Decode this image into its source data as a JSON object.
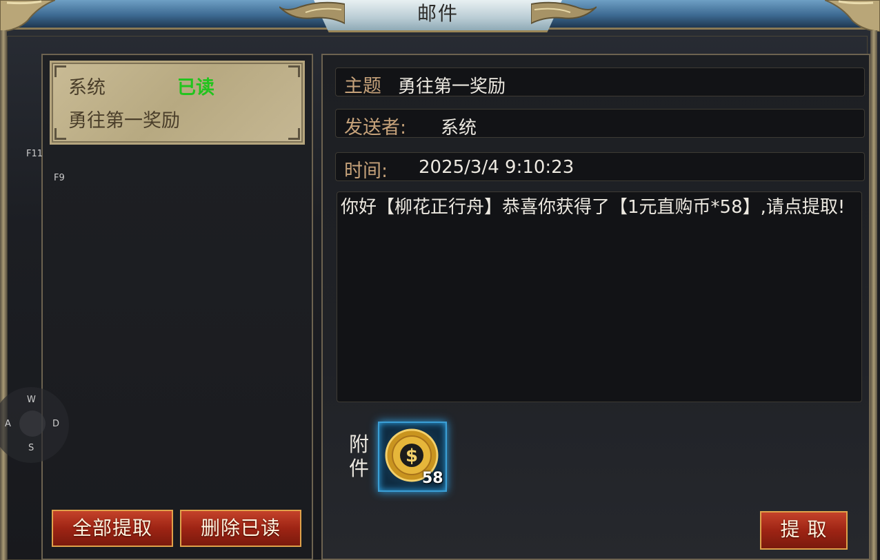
{
  "window": {
    "title": "邮件"
  },
  "mail_list": {
    "items": [
      {
        "sender": "系统",
        "status": "已读",
        "subject": "勇往第一奖励"
      }
    ],
    "buttons": {
      "claim_all": "全部提取",
      "delete_read": "删除已读"
    }
  },
  "mail_detail": {
    "subject_label": "主题",
    "subject_value": "勇往第一奖励",
    "sender_label": "发送者:",
    "sender_value": "系统",
    "time_label": "时间:",
    "time_value": "2025/3/4 9:10:23",
    "body": "你好【柳花正行舟】恭喜你获得了【1元直购币*58】,请点提取!",
    "attachment_label": "附件",
    "attachment": {
      "icon": "gold-coin-icon",
      "count": "58"
    },
    "claim_button": "提 取"
  },
  "hotkeys": {
    "f11": "F11",
    "f9": "F9",
    "up": "W",
    "left": "A",
    "right": "D",
    "down": "S"
  },
  "colors": {
    "read_status": "#22c41e",
    "label": "#c6a27a",
    "button": "#9e2414"
  }
}
